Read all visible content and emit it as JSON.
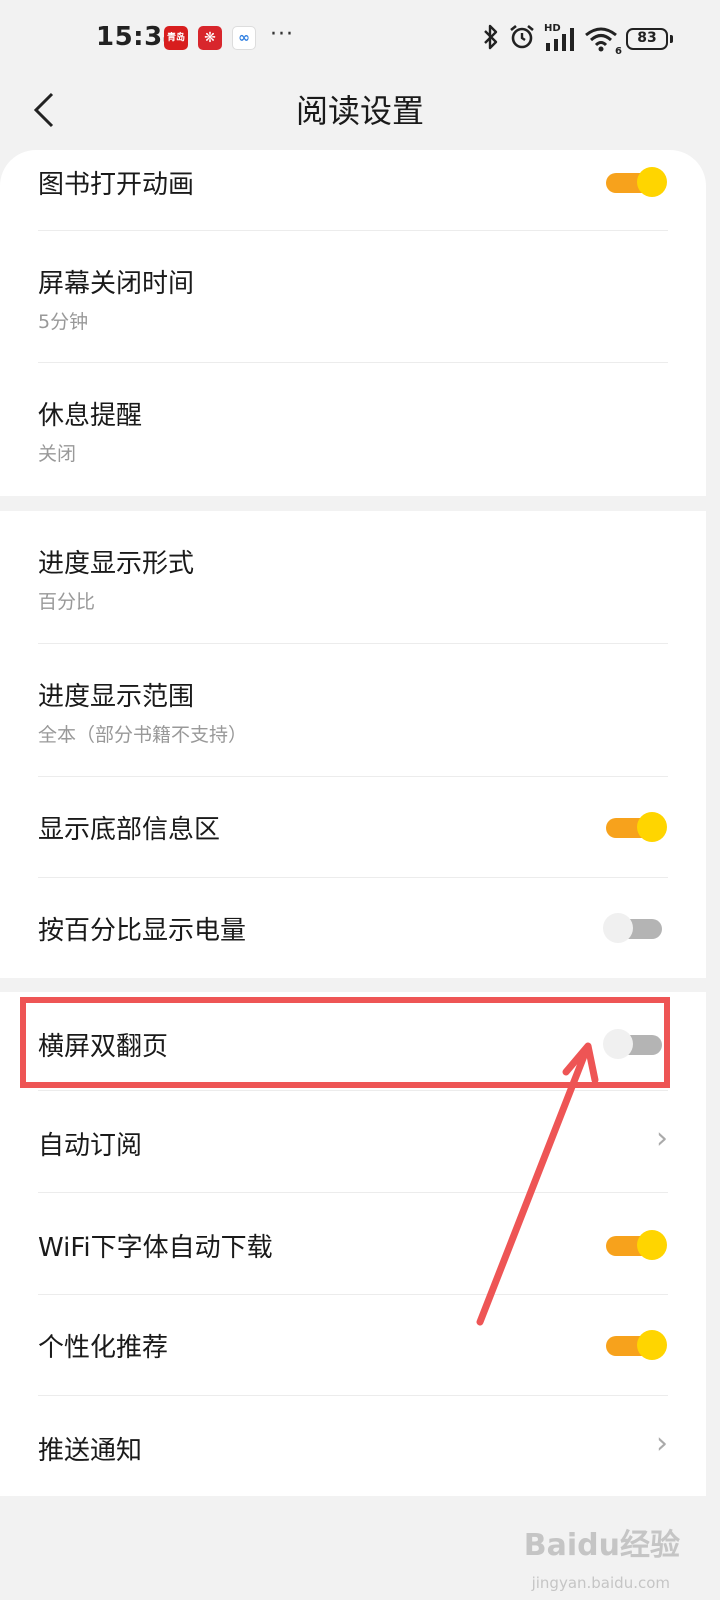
{
  "status_bar": {
    "time": "15:34",
    "badge1": "青岛",
    "badge2": "❋",
    "badge3": "∞",
    "more": "···",
    "network": "HD",
    "wifi_index": "6",
    "battery": "83"
  },
  "header": {
    "title": "阅读设置"
  },
  "section1": {
    "book_open_animation": {
      "label": "图书打开动画",
      "on": true
    },
    "screen_off_time": {
      "label": "屏幕关闭时间",
      "value": "5分钟"
    },
    "rest_reminder": {
      "label": "休息提醒",
      "value": "关闭"
    }
  },
  "section2": {
    "progress_format": {
      "label": "进度显示形式",
      "value": "百分比"
    },
    "progress_range": {
      "label": "进度显示范围",
      "value": "全本（部分书籍不支持）"
    },
    "bottom_info": {
      "label": "显示底部信息区",
      "on": true
    },
    "battery_percent": {
      "label": "按百分比显示电量",
      "on": false
    }
  },
  "section3": {
    "landscape_double": {
      "label": "横屏双翻页",
      "on": false
    },
    "auto_subscribe": {
      "label": "自动订阅"
    },
    "wifi_font_download": {
      "label": "WiFi下字体自动下载",
      "on": true
    },
    "personalized": {
      "label": "个性化推荐",
      "on": true
    },
    "push_notify": {
      "label": "推送通知"
    }
  },
  "annotation": {
    "color": "#ee5555"
  },
  "colors": {
    "toggle_on_track": "#f7a21c",
    "toggle_on_knob": "#ffd500",
    "toggle_off_track": "#b4b4b4"
  },
  "watermark": {
    "main": "Baidu经验",
    "sub": "jingyan.baidu.com"
  }
}
